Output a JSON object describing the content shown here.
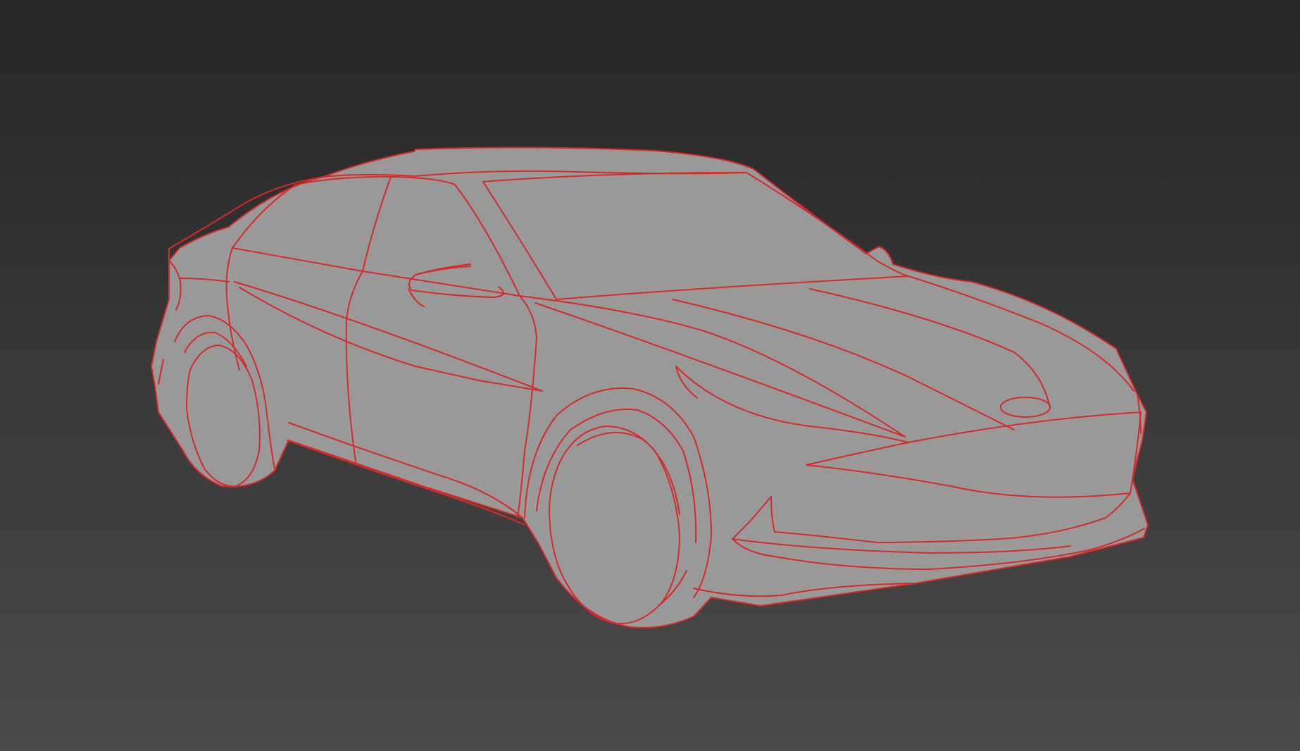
{
  "viewport": {
    "background_top": "#262626",
    "background_bottom": "#4a4a4a",
    "model": {
      "fill": "#999999",
      "edge_color": "#d42a2a",
      "shading": "flat-with-edged-faces"
    }
  }
}
